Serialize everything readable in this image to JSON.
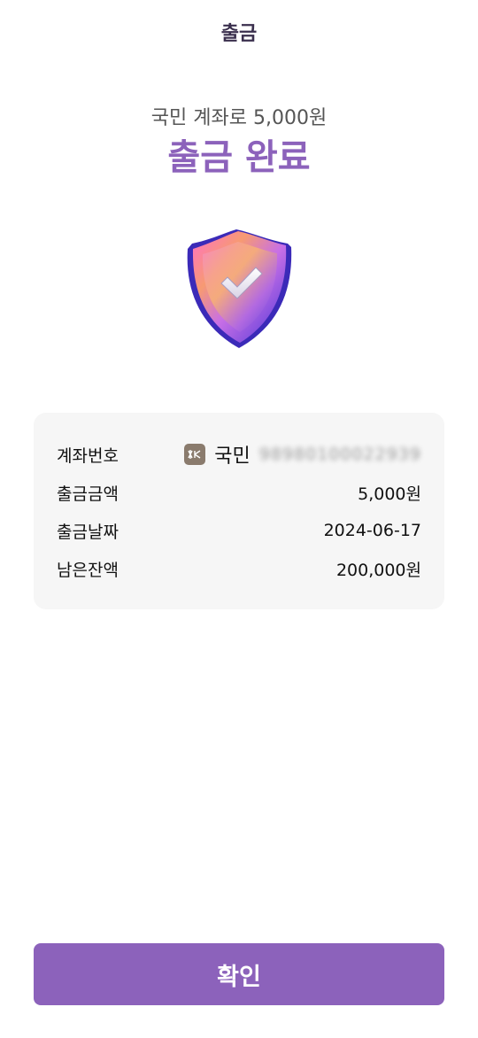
{
  "header": {
    "title": "출금"
  },
  "result": {
    "subtitle": "국민 계좌로 5,000원",
    "headline": "출금 완료"
  },
  "icons": {
    "status": "shield-check-icon",
    "bank": "kb-bank-logo-icon"
  },
  "colors": {
    "accent": "#8c62bb",
    "card_bg": "#f6f6f6",
    "bank_logo_bg": "#8a7b6d"
  },
  "details": {
    "account": {
      "label": "계좌번호",
      "bank": "국민",
      "number": "98980100022939"
    },
    "amount": {
      "label": "출금금액",
      "value": "5,000원"
    },
    "date": {
      "label": "출금날짜",
      "value": "2024-06-17"
    },
    "balance": {
      "label": "남은잔액",
      "value": "200,000원"
    }
  },
  "footer": {
    "confirm_label": "확인"
  }
}
